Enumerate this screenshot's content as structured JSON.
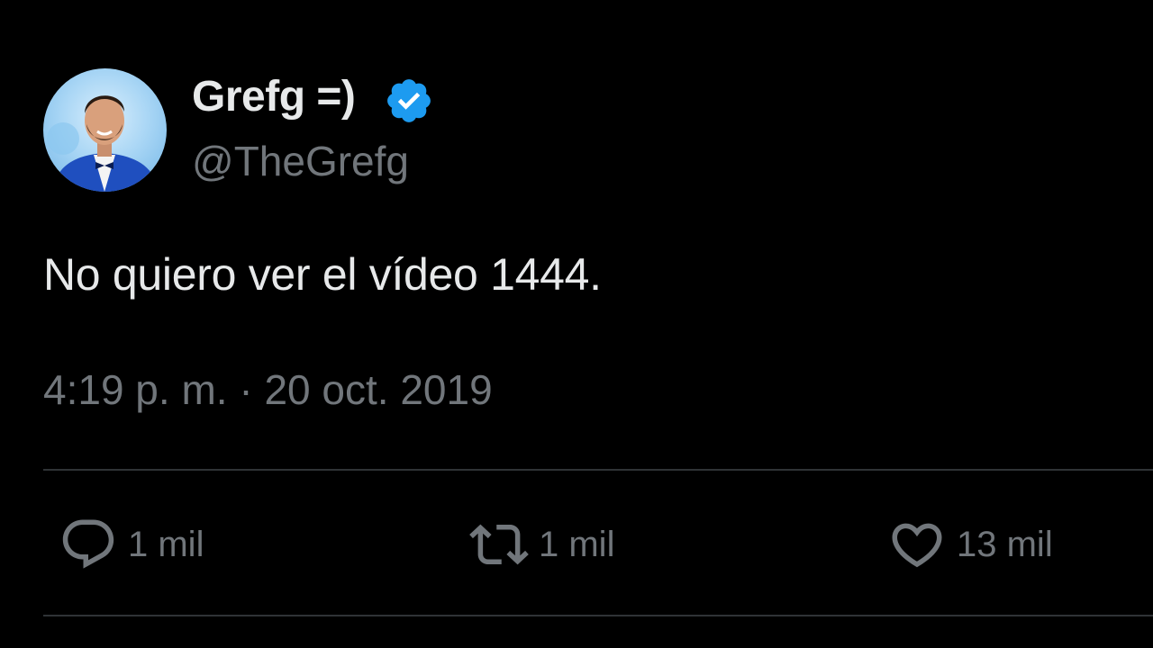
{
  "author": {
    "display_name": "Grefg =)",
    "handle": "@TheGrefg",
    "verified": true,
    "avatar_icon": "profile-photo",
    "verified_icon": "verified-badge-icon",
    "verified_color": "#1d9bf0"
  },
  "tweet": {
    "text": "No quiero ver el vídeo 1444.",
    "time": "4:19 p. m.",
    "separator": " · ",
    "date": "20 oct. 2019"
  },
  "actions": {
    "reply": {
      "icon": "reply-icon",
      "count": "1 mil"
    },
    "retweet": {
      "icon": "retweet-icon",
      "count": "1 mil"
    },
    "like": {
      "icon": "heart-icon",
      "count": "13 mil"
    }
  },
  "colors": {
    "background": "#000000",
    "primary_text": "#e7e9ea",
    "secondary_text": "#71767b",
    "divider": "#2f3336"
  }
}
